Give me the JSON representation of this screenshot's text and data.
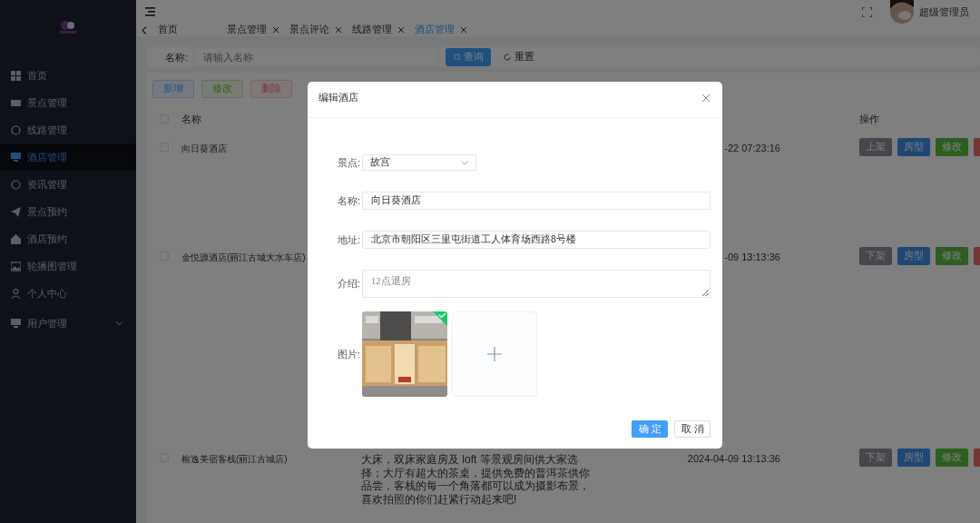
{
  "sidebar": {
    "items": [
      {
        "label": "首页",
        "selected": false,
        "expandable": false
      },
      {
        "label": "景点管理",
        "selected": false,
        "expandable": false
      },
      {
        "label": "线路管理",
        "selected": false,
        "expandable": false
      },
      {
        "label": "酒店管理",
        "selected": true,
        "expandable": false
      },
      {
        "label": "资讯管理",
        "selected": false,
        "expandable": false
      },
      {
        "label": "景点预约",
        "selected": false,
        "expandable": false
      },
      {
        "label": "酒店预约",
        "selected": false,
        "expandable": false
      },
      {
        "label": "轮播图管理",
        "selected": false,
        "expandable": false
      },
      {
        "label": "个人中心",
        "selected": false,
        "expandable": false
      },
      {
        "label": "用户管理",
        "selected": false,
        "expandable": true
      }
    ]
  },
  "header": {
    "user_name": "超级管理员"
  },
  "tabs": [
    {
      "label": "首页",
      "selected": false,
      "closable": false
    },
    {
      "label": "景点管理",
      "selected": false,
      "closable": true
    },
    {
      "label": "景点评论",
      "selected": false,
      "closable": true
    },
    {
      "label": "线路管理",
      "selected": false,
      "closable": true
    },
    {
      "label": "酒店管理",
      "selected": true,
      "closable": true
    }
  ],
  "search": {
    "label": "名称:",
    "placeholder": "请输入名称",
    "query_button": "查询",
    "reset_button": "重置"
  },
  "toolbar": [
    {
      "label": "新增",
      "kind": "add"
    },
    {
      "label": "修改",
      "kind": "edit"
    },
    {
      "label": "删除",
      "kind": "delete"
    }
  ],
  "table": {
    "columns": {
      "name": "名称",
      "actions": "操作"
    },
    "header_checked": false,
    "rows": [
      {
        "checked": false,
        "name": "向日葵酒店",
        "time": "-22 07:23:16",
        "actions": [
          {
            "kind": "neutral",
            "label": "上架"
          },
          {
            "kind": "primary",
            "label": "房型"
          },
          {
            "kind": "success",
            "label": "修改"
          },
          {
            "kind": "danger"
          }
        ]
      },
      {
        "checked": false,
        "name": "金悦源酒店(丽江古城大水车店)",
        "time": "-09 13:13:36",
        "actions": [
          {
            "kind": "neutral",
            "label": "下架"
          },
          {
            "kind": "primary",
            "label": "房型"
          },
          {
            "kind": "success",
            "label": "修改"
          },
          {
            "kind": "danger"
          }
        ]
      },
      {
        "checked": false,
        "name": "榕逸美宿客栈(丽江古城店)",
        "description": "大床，双床家庭房及 loft 等景观房间供大家选择；大厅有超大的茶桌，提供免费的普洱茶供你品尝，客栈的每一个角落都可以成为摄影布景，喜欢拍照的你们赶紧行动起来吧!",
        "time": "2024-04-09 13:13:36",
        "actions": [
          {
            "kind": "neutral",
            "label": "下架"
          },
          {
            "kind": "primary",
            "label": "房型"
          },
          {
            "kind": "success",
            "label": "修改"
          },
          {
            "kind": "danger"
          }
        ]
      }
    ]
  },
  "dialog": {
    "title": "编辑酒店",
    "fields": [
      {
        "kind": "select",
        "label": "景点:",
        "value": "故宫"
      },
      {
        "kind": "input",
        "label": "名称:",
        "value": "向日葵酒店"
      },
      {
        "kind": "input",
        "label": "地址:",
        "value": "北京市朝阳区三里屯街道工人体育场西路8号楼"
      },
      {
        "kind": "textarea",
        "label": "介绍:",
        "placeholder": "12点退房"
      },
      {
        "kind": "upload",
        "label": "图片:",
        "uploaded": true
      }
    ],
    "confirm_button": "确定",
    "cancel_button": "取消"
  }
}
